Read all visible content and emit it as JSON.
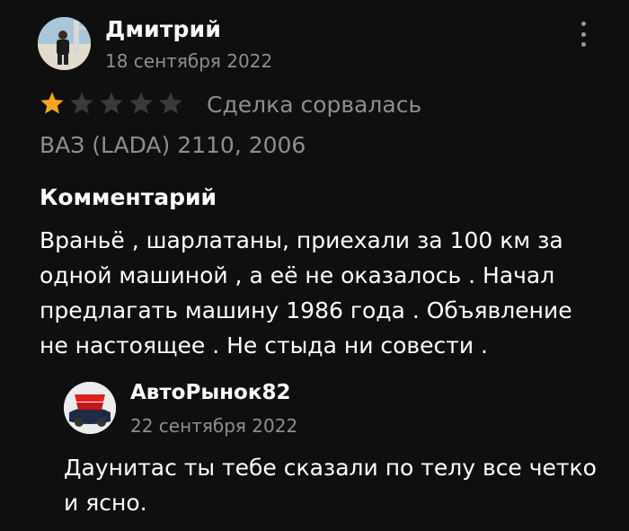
{
  "review": {
    "author_name": "Дмитрий",
    "date": "18 сентября 2022",
    "rating": 1,
    "rating_max": 5,
    "deal_status": "Сделка сорвалась",
    "car": "ВАЗ (LADA) 2110, 2006",
    "comment_heading": "Комментарий",
    "comment_text": "Враньё , шарлатаны, приехали за 100 км за одной машиной , а её не оказалось . Начал предлагать машину 1986 года . Объявление не настоящее . Не стыда ни совести ."
  },
  "reply": {
    "author_name": "АвтоРынок82",
    "avatar_logo_text": "Авто Рынок82",
    "date": "22 сентября 2022",
    "text": "Даунитас ты тебе сказали по телу все четко и ясно."
  },
  "icons": {
    "more": "more-vertical-icon",
    "star": "star-icon"
  },
  "colors": {
    "background": "#0f0f0f",
    "text_primary": "#ffffff",
    "text_secondary": "#8e8e8e",
    "star_filled": "#f5a623",
    "star_empty": "#3a3a3a"
  }
}
